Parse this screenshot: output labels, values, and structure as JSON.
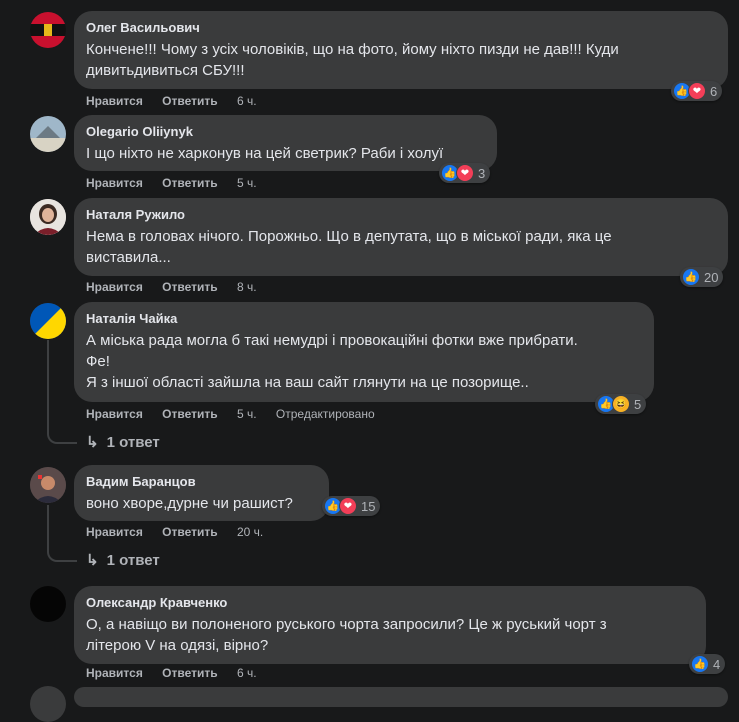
{
  "comments": [
    {
      "author": "Олег Васильович",
      "text": "Кончене!!! Чому з усіх чоловіків, що на фото, йому ніхто пизди не дав!!! Куди\nдивитьдивиться СБУ!!!",
      "like": "Нравится",
      "reply": "Ответить",
      "time": "6 ч.",
      "reactions": "6"
    },
    {
      "author": "Olegario Oliiynyk",
      "text": "І що ніхто не харконув на цей светрик? Раби і холуї",
      "like": "Нравится",
      "reply": "Ответить",
      "time": "5 ч.",
      "reactions": "3"
    },
    {
      "author": "Наталя Ружило",
      "text": "Нема в головах нічого. Порожньо. Що в депутата, що в міської ради, яка це\nвиставила...",
      "like": "Нравится",
      "reply": "Ответить",
      "time": "8 ч.",
      "reactions": "20"
    },
    {
      "author": "Наталія Чайка",
      "text": "А міська рада могла б такі немудрі і провокаційні фотки вже прибрати.\nФе!\nЯ з іншої області зайшла на ваш сайт глянути на це позорище..",
      "like": "Нравится",
      "reply": "Ответить",
      "time": "5 ч.",
      "edited": "Отредактировано",
      "reactions": "5",
      "replies": "1 ответ"
    },
    {
      "author": "Вадим Баранцов",
      "text": "воно хворе,дурне чи рашист?",
      "like": "Нравится",
      "reply": "Ответить",
      "time": "20 ч.",
      "reactions": "15",
      "replies": "1 ответ"
    },
    {
      "author": "Олександр Кравченко",
      "text": "О, а навіщо ви полоненого руського чорта запросили? Це ж руський чорт з\nлітерою V на одязі, вірно?",
      "like": "Нравится",
      "reply": "Ответить",
      "time": "6 ч.",
      "reactions": "4"
    }
  ],
  "icons": {
    "like": "thumbs-up-icon",
    "love": "heart-icon",
    "haha": "laugh-icon",
    "reply_arrow": "reply-arrow-icon"
  },
  "colors": {
    "like": "#1877f2",
    "love": "#f33e58",
    "haha": "#f7b125"
  }
}
